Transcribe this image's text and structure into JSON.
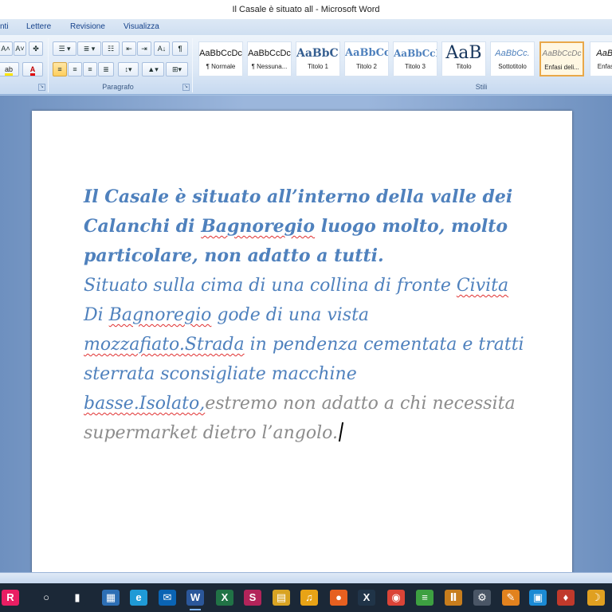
{
  "window": {
    "title": "Il Casale è situato all  -  Microsoft Word"
  },
  "tabs": [
    "nti",
    "Lettere",
    "Revisione",
    "Visualizza"
  ],
  "ribbon": {
    "font_group": {
      "grow_font": "A˄",
      "shrink_font": "A˅",
      "highlight": "ab",
      "font_color": "A"
    },
    "paragraph_group": {
      "label": "Paragrafo",
      "sort": "A↓",
      "show_marks": "¶"
    },
    "styles_group": {
      "label": "Stili",
      "styles": [
        {
          "preview": "AaBbCcDc",
          "name": "¶ Normale"
        },
        {
          "preview": "AaBbCcDc",
          "name": "¶ Nessuna..."
        },
        {
          "preview": "AaBbC‹",
          "name": "Titolo 1"
        },
        {
          "preview": "AaBbCc",
          "name": "Titolo 2"
        },
        {
          "preview": "AaBbCcI",
          "name": "Titolo 3"
        },
        {
          "preview": "AaB",
          "name": "Titolo"
        },
        {
          "preview": "AaBbCc.",
          "name": "Sottotitolo"
        },
        {
          "preview": "AaBbCcDc",
          "name": "Enfasi deli..."
        },
        {
          "preview": "AaBl",
          "name": "Enfas"
        }
      ]
    }
  },
  "document": {
    "bold_part": {
      "t1": "Il Casale è situato all’interno della valle dei Calanchi di ",
      "w1": "Bagnoregio",
      "t2": " luogo molto, molto particolare, non adatto a tutti."
    },
    "body": {
      "t1": "Situato sulla cima di una collina di fronte ",
      "w1": "Civita",
      "t2": " Di ",
      "w2": "Bagnoregio",
      "t3": " gode di una vista ",
      "w3": "mozzafiato.Strada",
      "t4": " in pendenza cementata e tratti sterrata sconsigliate macchine ",
      "w4": "basse.Isolato,",
      "t5": "estremo non adatto a chi necessita supermarket dietro l’angolo."
    }
  },
  "taskbar": {
    "items": [
      {
        "icon": "ribbon-app-icon",
        "glyph": "R",
        "color": "#e91e63"
      },
      {
        "icon": "search-circle-icon",
        "glyph": "○",
        "color": "#1b2837"
      },
      {
        "icon": "task-view-icon",
        "glyph": "▮",
        "color": "#1b2837"
      },
      {
        "icon": "calculator-icon",
        "glyph": "▦",
        "color": "#2d6fb5"
      },
      {
        "icon": "edge-icon",
        "glyph": "e",
        "color": "#1f9ad6"
      },
      {
        "icon": "mail-icon",
        "glyph": "✉",
        "color": "#0a64b4"
      },
      {
        "icon": "word-icon",
        "glyph": "W",
        "color": "#2b579a"
      },
      {
        "icon": "excel-icon",
        "glyph": "X",
        "color": "#217346"
      },
      {
        "icon": "onenote-icon",
        "glyph": "S",
        "color": "#b3245a"
      },
      {
        "icon": "file-explorer-icon",
        "glyph": "▤",
        "color": "#d8a323"
      },
      {
        "icon": "music-app-icon",
        "glyph": "♫",
        "color": "#e8a316"
      },
      {
        "icon": "firefox-icon",
        "glyph": "●",
        "color": "#e66020"
      },
      {
        "icon": "xbox-icon",
        "glyph": "X",
        "color": "#203448"
      },
      {
        "icon": "chrome-icon",
        "glyph": "◉",
        "color": "#db4437"
      },
      {
        "icon": "notepad-icon",
        "glyph": "≡",
        "color": "#3da041"
      },
      {
        "icon": "books-icon",
        "glyph": "Ⅱ",
        "color": "#c77d1d"
      },
      {
        "icon": "settings-gear-icon",
        "glyph": "⚙",
        "color": "#4a5666"
      },
      {
        "icon": "paint-icon",
        "glyph": "✎",
        "color": "#e2821e"
      },
      {
        "icon": "photos-icon",
        "glyph": "▣",
        "color": "#1b8ad4"
      },
      {
        "icon": "app-red-icon",
        "glyph": "♦",
        "color": "#c0392b"
      },
      {
        "icon": "moon-icon",
        "glyph": "☽",
        "color": "#e0a020"
      }
    ]
  }
}
